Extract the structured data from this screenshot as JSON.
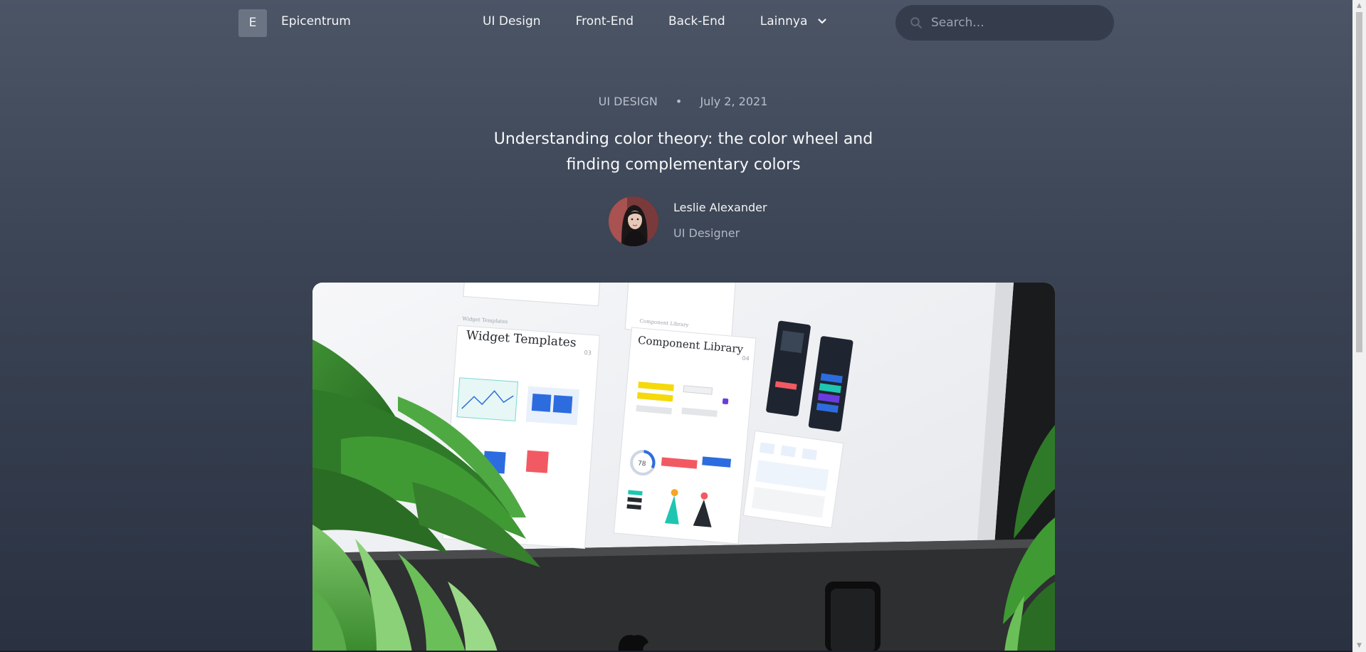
{
  "nav": {
    "logo_letter": "E",
    "brand": "Epicentrum",
    "links": [
      "UI Design",
      "Front-End",
      "Back-End",
      "Lainnya"
    ],
    "search_placeholder": "Search..."
  },
  "article": {
    "category": "UI DESIGN",
    "separator": "•",
    "date": "July 2, 2021",
    "title": "Understanding color theory: the color wheel and finding complementary colors",
    "author": {
      "name": "Leslie Alexander",
      "role": "UI Designer"
    }
  },
  "hero_image": {
    "screen_text_1": "Widget Templates",
    "screen_text_2": "Component Library",
    "small_label_1": "Widget Templates",
    "small_label_2": "Component Library",
    "page_num_1": "03",
    "page_num_2": "04",
    "gauge_value": "78"
  },
  "colors": {
    "accent_yellow": "#f5d90a",
    "accent_blue": "#2d6cdf",
    "accent_red": "#f25a63",
    "accent_teal": "#1ec6b2",
    "accent_purple": "#6a3ce0"
  }
}
